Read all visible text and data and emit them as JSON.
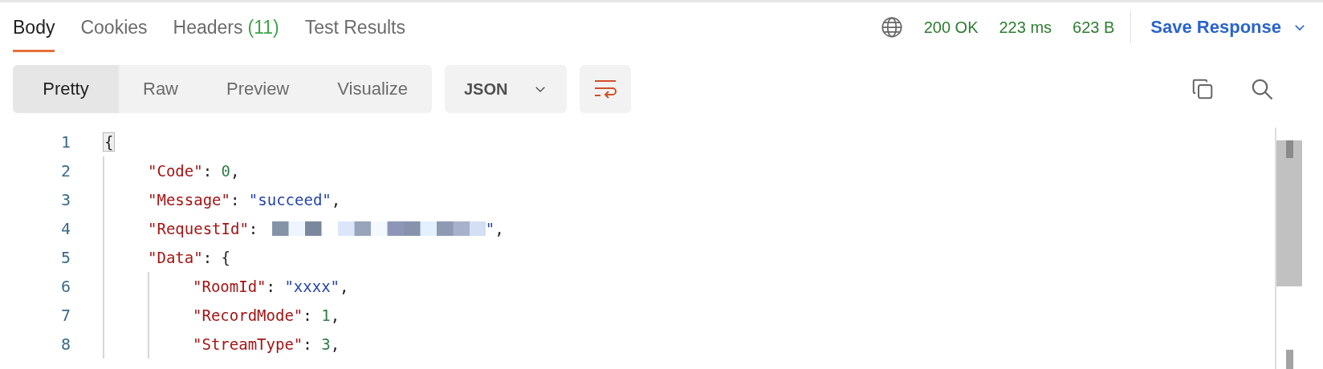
{
  "tabs": [
    {
      "label": "Body",
      "selected": true
    },
    {
      "label": "Cookies",
      "selected": false
    },
    {
      "label": "Headers",
      "count": "(11)",
      "selected": false
    },
    {
      "label": "Test Results",
      "selected": false
    }
  ],
  "status": {
    "code": "200 OK",
    "time": "223 ms",
    "size": "623 B"
  },
  "save_button": "Save Response",
  "view_modes": [
    {
      "label": "Pretty",
      "selected": true
    },
    {
      "label": "Raw",
      "selected": false
    },
    {
      "label": "Preview",
      "selected": false
    },
    {
      "label": "Visualize",
      "selected": false
    }
  ],
  "format": "JSON",
  "wrap": {
    "on": true
  },
  "code_lines": [
    {
      "number": "1",
      "tokens": [
        {
          "kind": "brace",
          "text": "{"
        }
      ],
      "children": [
        {
          "number": "2",
          "tokens": [
            {
              "kind": "key",
              "text": "\"Code\""
            },
            {
              "kind": "punct",
              "text": ": "
            },
            {
              "kind": "number",
              "text": "0"
            },
            {
              "kind": "punct",
              "text": ","
            }
          ]
        },
        {
          "number": "3",
          "tokens": [
            {
              "kind": "key",
              "text": "\"Message\""
            },
            {
              "kind": "punct",
              "text": ": "
            },
            {
              "kind": "string",
              "text": "\"succeed\""
            },
            {
              "kind": "punct",
              "text": ","
            }
          ]
        },
        {
          "number": "4",
          "tokens": [
            {
              "kind": "key",
              "text": "\"RequestId\""
            },
            {
              "kind": "punct",
              "text": ": "
            },
            {
              "kind": "redacted"
            },
            {
              "kind": "string",
              "text": "\""
            },
            {
              "kind": "punct",
              "text": ","
            }
          ]
        },
        {
          "number": "5",
          "tokens": [
            {
              "kind": "key",
              "text": "\"Data\""
            },
            {
              "kind": "punct",
              "text": ": {"
            }
          ],
          "children": [
            {
              "number": "6",
              "tokens": [
                {
                  "kind": "key",
                  "text": "\"RoomId\""
                },
                {
                  "kind": "punct",
                  "text": ": "
                },
                {
                  "kind": "string",
                  "text": "\"xxxx\""
                },
                {
                  "kind": "punct",
                  "text": ","
                }
              ]
            },
            {
              "number": "7",
              "tokens": [
                {
                  "kind": "key",
                  "text": "\"RecordMode\""
                },
                {
                  "kind": "punct",
                  "text": ": "
                },
                {
                  "kind": "number",
                  "text": "1"
                },
                {
                  "kind": "punct",
                  "text": ","
                }
              ]
            },
            {
              "number": "8",
              "tokens": [
                {
                  "kind": "key",
                  "text": "\"StreamType\""
                },
                {
                  "kind": "punct",
                  "text": ": "
                },
                {
                  "kind": "number",
                  "text": "3"
                },
                {
                  "kind": "punct",
                  "text": ","
                }
              ]
            }
          ]
        }
      ]
    }
  ]
}
